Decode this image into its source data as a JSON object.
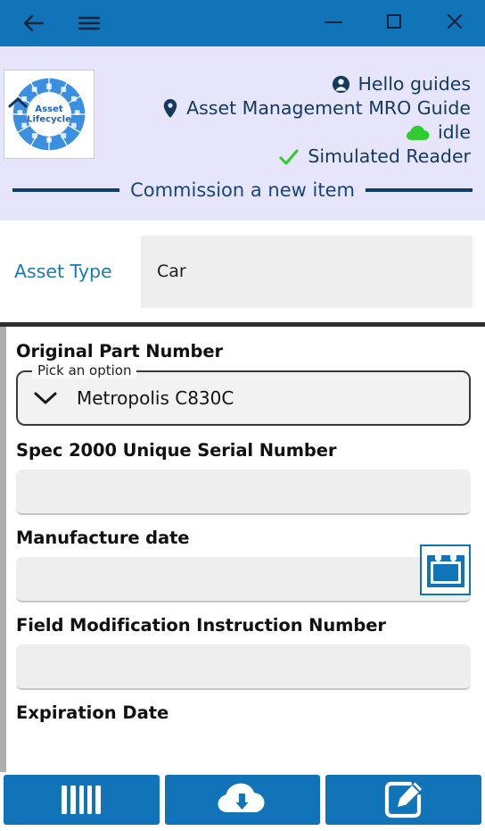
{
  "titlebar": {
    "back_icon": "arrow-left-icon",
    "menu_icon": "hamburger-menu-icon",
    "minimize_icon": "minimize-icon",
    "maximize_icon": "maximize-icon",
    "close_icon": "close-icon",
    "background_color": "#1173b8"
  },
  "header": {
    "collapse_icon": "chevron-up-icon",
    "background_color": "#e7e5fb",
    "logo": {
      "name": "asset-lifecycle-logo",
      "line1": "Asset",
      "line2": "Lifecycle"
    },
    "user_line": {
      "icon": "user-account-icon",
      "text": "Hello guides"
    },
    "location_line": {
      "icon": "map-pin-icon",
      "text": "Asset Management MRO Guide"
    },
    "status_line": {
      "icon": "cloud-icon",
      "text": "idle",
      "icon_color": "#2ecc2e"
    },
    "reader_line": {
      "icon": "check-icon",
      "text": "Simulated Reader",
      "icon_color": "#2ecc2e"
    },
    "section_title": "Commission a new item",
    "rule_color": "#0d3f6e"
  },
  "asset_type": {
    "label": "Asset Type",
    "value": "Car",
    "label_color": "#1a7ab2"
  },
  "form": {
    "fields": [
      {
        "label": "Original Part Number",
        "type": "select",
        "legend": "Pick an option",
        "value": "Metropolis C830C",
        "chevron_icon": "chevron-down-icon"
      },
      {
        "label": "Spec 2000 Unique Serial Number",
        "type": "text",
        "value": "",
        "placeholder": ""
      },
      {
        "label": "Manufacture date",
        "type": "date",
        "value": "",
        "placeholder": "",
        "icon": "calendar-icon"
      },
      {
        "label": "Field Modification Instruction Number",
        "type": "text",
        "value": "",
        "placeholder": ""
      },
      {
        "label": "Expiration Date",
        "type": "text",
        "value": "",
        "placeholder": ""
      }
    ]
  },
  "bottombar": {
    "buttons": [
      {
        "name": "barcode-scan-button",
        "icon": "barcode-icon"
      },
      {
        "name": "cloud-download-button",
        "icon": "cloud-download-icon"
      },
      {
        "name": "manual-entry-button",
        "icon": "edit-square-icon"
      }
    ],
    "button_color": "#1173b8"
  }
}
